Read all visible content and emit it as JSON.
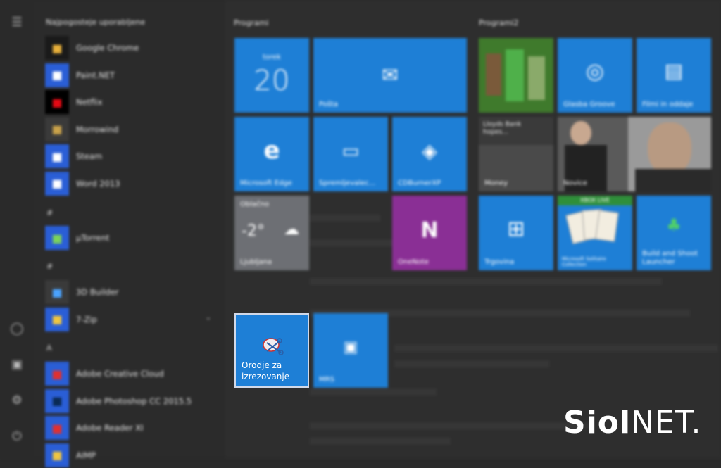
{
  "applist": {
    "most_used_header": "Najpogosteje uporabljene",
    "most_used": [
      {
        "label": "Google Chrome",
        "icon": "chrome-icon",
        "bg": "#1a1a1a",
        "color": "#e8b03a"
      },
      {
        "label": "Paint.NET",
        "icon": "paint-net-icon",
        "bg": "#2a5ed6",
        "color": "#ffffff"
      },
      {
        "label": "Netflix",
        "icon": "netflix-icon",
        "bg": "#000000",
        "color": "#e50914"
      },
      {
        "label": "Morrowind",
        "icon": "morrowind-icon",
        "bg": "#3a3a3a",
        "color": "#c9a24a"
      },
      {
        "label": "Steam",
        "icon": "steam-icon",
        "bg": "#2a5ed6",
        "color": "#ffffff"
      },
      {
        "label": "Word 2013",
        "icon": "word-icon",
        "bg": "#2a5ed6",
        "color": "#ffffff"
      }
    ],
    "letter_hash": "#",
    "hash_apps": [
      {
        "label": "µTorrent",
        "icon": "utorrent-icon",
        "bg": "#2a5ed6",
        "color": "#7cd35a"
      }
    ],
    "letter_digit": "#",
    "digit_apps": [
      {
        "label": "3D Builder",
        "icon": "3d-builder-icon",
        "bg": "#3a3a3a",
        "color": "#4aa3ff"
      },
      {
        "label": "7-Zip",
        "icon": "folder-icon",
        "bg": "#2a5ed6",
        "color": "#f0c640"
      }
    ],
    "letter_a": "A",
    "a_apps": [
      {
        "label": "Adobe Creative Cloud",
        "icon": "creative-cloud-icon",
        "bg": "#2a5ed6",
        "color": "#e03030"
      },
      {
        "label": "Adobe Photoshop CC 2015.5",
        "icon": "photoshop-icon",
        "bg": "#2a5ed6",
        "color": "#0a2a55"
      },
      {
        "label": "Adobe Reader XI",
        "icon": "adobe-reader-icon",
        "bg": "#2a5ed6",
        "color": "#e03030"
      },
      {
        "label": "AIMP",
        "icon": "aimp-icon",
        "bg": "#2a5ed6",
        "color": "#f0c640"
      }
    ]
  },
  "tiles": {
    "group1_header": "Programi",
    "group2_header": "Programi2",
    "calendar_day": "torek",
    "calendar_date": "20",
    "mail_label": "Pošta",
    "edge_label": "Microsoft Edge",
    "devices_label": "Spremljevalec...",
    "cdburner_label": "CDBurnerXP",
    "weather_top": "Oblačno",
    "weather_temp": "-2°",
    "weather_city": "Ljubljana",
    "onenote_label": "OneNote",
    "groove_label": "Glasba Groove",
    "films_label": "Filmi in oddaje",
    "news_label": "Novice",
    "money_label": "Money",
    "money_text": "Lloyds Bank hopes...",
    "store_label": "Trgovina",
    "xbox_live": "XBOX LIVE",
    "solitaire_label": "Microsoft Solitaire Collection",
    "bubble_label": "Build and Shoot Launcher",
    "snip_label": "Orodje za izrezovanje",
    "mrs_label": "MRS"
  },
  "logo": {
    "bold": "Siol",
    "rest": "NET."
  }
}
